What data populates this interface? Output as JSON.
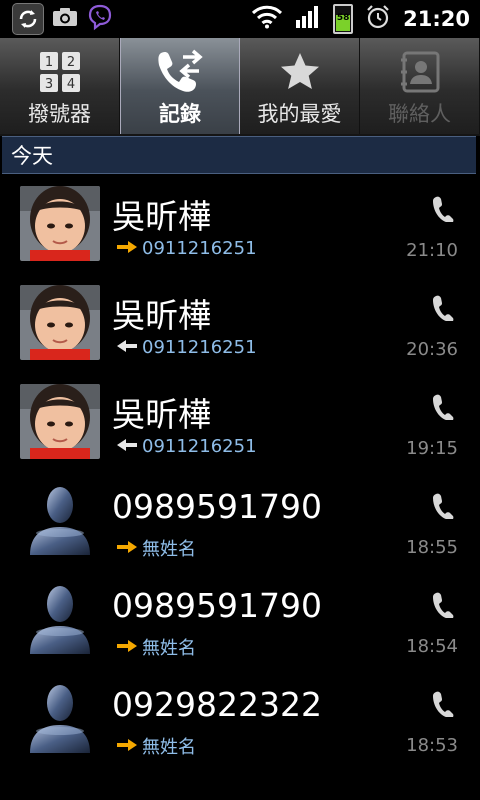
{
  "status_bar": {
    "time": "21:20",
    "battery": "58",
    "icons": [
      "sync-icon",
      "camera-icon",
      "viber-icon",
      "wifi-icon",
      "signal-icon",
      "battery-icon",
      "alarm-icon"
    ]
  },
  "tabs": [
    {
      "label": "撥號器",
      "icon": "dialpad-icon",
      "active": false
    },
    {
      "label": "記錄",
      "icon": "call-log-icon",
      "active": true
    },
    {
      "label": "我的最愛",
      "icon": "star-icon",
      "active": false
    },
    {
      "label": "聯絡人",
      "icon": "contacts-icon",
      "active": false,
      "dimmed": true
    }
  ],
  "section": {
    "title": "今天"
  },
  "calls": [
    {
      "name": "吳昕樺",
      "number": "0911216251",
      "direction": "outgoing",
      "time": "21:10",
      "avatar": "photo"
    },
    {
      "name": "吳昕樺",
      "number": "0911216251",
      "direction": "incoming",
      "time": "20:36",
      "avatar": "photo"
    },
    {
      "name": "吳昕樺",
      "number": "0911216251",
      "direction": "incoming",
      "time": "19:15",
      "avatar": "photo"
    },
    {
      "name": "0989591790",
      "number": "無姓名",
      "direction": "outgoing",
      "time": "18:55",
      "avatar": "placeholder"
    },
    {
      "name": "0989591790",
      "number": "無姓名",
      "direction": "outgoing",
      "time": "18:54",
      "avatar": "placeholder"
    },
    {
      "name": "0929822322",
      "number": "無姓名",
      "direction": "outgoing",
      "time": "18:53",
      "avatar": "placeholder"
    }
  ],
  "colors": {
    "outgoing_arrow": "#f5a800",
    "incoming_arrow": "#e6e6e6",
    "number_text": "#8fbde8",
    "section_bg": "#1c2b44"
  }
}
